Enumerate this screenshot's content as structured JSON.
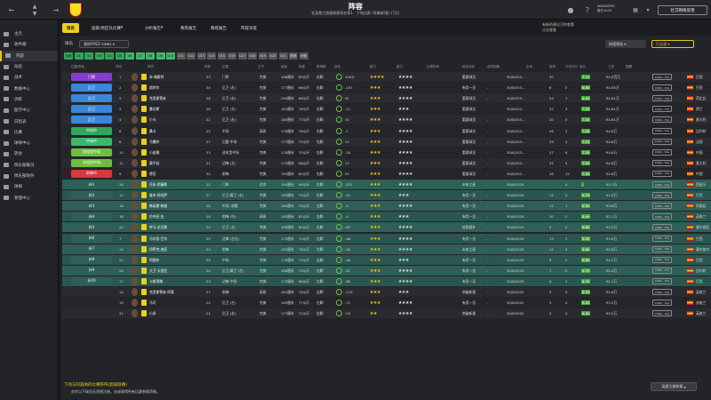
{
  "topbar": {
    "title": "阵容",
    "subtitle": "在英格兰超级联赛排名第1 - 下场比赛: 阿森纳(客) (7天)",
    "club_button": "社交网络反馈",
    "manager_line1": "WAKSATRO",
    "manager_line2": "周日 8:00"
  },
  "sidebar": {
    "items": [
      {
        "label": "主页",
        "active": false
      },
      {
        "label": "收件箱",
        "active": false
      },
      {
        "label": "阵容",
        "active": true
      },
      {
        "label": "动态",
        "active": false
      },
      {
        "label": "战术",
        "active": false
      },
      {
        "label": "数据中心",
        "active": false
      },
      {
        "label": "训练",
        "active": false
      },
      {
        "label": "医疗中心",
        "active": false
      },
      {
        "label": "日程表",
        "active": false
      },
      {
        "label": "比赛",
        "active": false
      },
      {
        "label": "球探中心",
        "active": false
      },
      {
        "label": "转会",
        "active": false
      },
      {
        "label": "俱乐部概况",
        "active": false
      },
      {
        "label": "俱乐部财务",
        "active": false
      },
      {
        "label": "球探",
        "active": false
      },
      {
        "label": "管理中心",
        "active": false
      }
    ]
  },
  "tabs": [
    {
      "label": "球员",
      "active": true
    },
    {
      "label": "国家/地区队比赛",
      "active": false
    },
    {
      "label": "分析报告",
      "active": false
    },
    {
      "label": "教练报告",
      "active": false
    },
    {
      "label": "教练报告",
      "active": false
    },
    {
      "label": "阵容深度",
      "active": false
    }
  ],
  "notice": {
    "line1": "有新的建议可供查看",
    "line2": "点击查看"
  },
  "filters": {
    "label": "球员",
    "view_select": "我的FM22 views",
    "quick_select": "快速筛选",
    "used_select": "已过滤"
  },
  "chips": [
    "全部",
    "U1",
    "U2",
    "U3",
    "U4",
    "U5",
    "U6",
    "U7",
    "U8",
    "U9",
    "U10",
    "U11",
    "U12",
    "U13",
    "U14",
    "U15",
    "U16",
    "U17",
    "U18",
    "U19",
    "U20",
    "U21",
    "联赛",
    "杯赛"
  ],
  "columns": [
    "位置/角色",
    "号码",
    "球员",
    "年龄",
    "位置",
    "主气",
    "身高",
    "体重",
    "惯用脚",
    "状态",
    "能力",
    "潜力",
    "比赛时间",
    "转会状态",
    "合同到期",
    "出场",
    "进球",
    "平均评分",
    "身价",
    "工资",
    "国籍"
  ],
  "colors": {
    "accent": "#f2cf1d",
    "gk": "#8a3bd4",
    "def": "#3a86d8",
    "dm": "#2fa85a",
    "mid": "#3cb86a",
    "wing": "#6fbf3f",
    "att": "#d63a3a",
    "sub": "#2f5f57"
  },
  "rows": [
    {
      "role": "门将",
      "pos_color": "#8a3bd4",
      "num": "1",
      "name": "本·福斯特",
      "age": "33",
      "pos": "门将",
      "pers": "完美",
      "height": "188厘米",
      "weight": "85公斤",
      "foot": "右脚",
      "status": "",
      "fitness": "100%",
      "ability": "★★★★",
      "potential": "★★★★",
      "time": "重要球员",
      "transfer": "-",
      "contract": "30/6/203...",
      "apps": "30",
      "goals": "-",
      "rating": "7.10",
      "value": "€4.8百万",
      "wage": "CS6K - CSL",
      "nat": "巴西"
    },
    {
      "role": "后卫",
      "pos_color": "#3a86d8",
      "num": "2",
      "name": "凯特尔",
      "age": "24",
      "pos": "后卫 (右)",
      "pers": "完美",
      "height": "177厘米",
      "weight": "66公斤",
      "foot": "右脚",
      "status": "",
      "fitness": "-157",
      "ability": "★★★",
      "potential": "★★★★",
      "time": "有用一员",
      "transfer": "-",
      "contract": "30/6/203...",
      "apps": "6",
      "goals": "0",
      "rating": "6.80",
      "value": "€4.85万",
      "wage": "CS6K - CSL",
      "nat": "巴西"
    },
    {
      "role": "后卫",
      "pos_color": "#3a86d8",
      "num": "5",
      "name": "克里斯蒂安",
      "age": "26",
      "pos": "后卫 (右)",
      "pers": "完美",
      "height": "194厘米",
      "weight": "86公斤",
      "foot": "右脚",
      "status": "",
      "fitness": "91",
      "ability": "★★★",
      "potential": "★★★★",
      "time": "重要球员",
      "transfer": "-",
      "contract": "30/6/203...",
      "apps": "24",
      "goals": "1",
      "rating": "6.90",
      "value": "€4.81万",
      "wage": "CS6K - CSL",
      "nat": "荷比比"
    },
    {
      "role": "后卫",
      "pos_color": "#3a86d8",
      "num": "3",
      "name": "桑切斯",
      "age": "28",
      "pos": "后卫 (左)",
      "pers": "完美",
      "height": "181厘米",
      "weight": "78公斤",
      "foot": "左脚",
      "status": "",
      "fitness": "-11",
      "ability": "★★★",
      "potential": "★★★",
      "time": "重要球员",
      "transfer": "-",
      "contract": "30/6/203...",
      "apps": "22",
      "goals": "3",
      "rating": "7.00",
      "value": "€4.81万",
      "wage": "CS6K - CSL",
      "nat": "荷兰"
    },
    {
      "role": "后卫",
      "pos_color": "#3a86d8",
      "num": "4",
      "name": "小卡",
      "age": "22",
      "pos": "后卫 (右)",
      "pers": "完美",
      "height": "180厘米",
      "weight": "77公斤",
      "foot": "右脚",
      "status": "",
      "fitness": "10",
      "ability": "★★★",
      "potential": "★★★★",
      "time": "重要球员",
      "transfer": "-",
      "contract": "30/6/203...",
      "apps": "20",
      "goals": "0",
      "rating": "7.10",
      "value": "€4.81万",
      "wage": "CS6K - CSL",
      "nat": "意大利"
    },
    {
      "role": "中场中",
      "pos_color": "#2fa85a",
      "num": "6",
      "name": "桑卡",
      "age": "25",
      "pos": "中场",
      "pers": "高昂",
      "height": "178厘米",
      "weight": "76公斤",
      "foot": "右脚",
      "status": "",
      "fitness": "-1",
      "ability": "★★★",
      "potential": "★★★★",
      "time": "重要球员",
      "transfer": "-",
      "contract": "30/6/203...",
      "apps": "26",
      "goals": "2",
      "rating": "7.00",
      "value": "€4.8万",
      "wage": "CS6K - CSL",
      "nat": "比利时"
    },
    {
      "role": "中场中",
      "pos_color": "#3cb86a",
      "num": "8",
      "name": "马撒朴",
      "age": "27",
      "pos": "后腰 中场",
      "pers": "完美",
      "height": "177厘米",
      "weight": "72公斤",
      "foot": "右脚",
      "status": "",
      "fitness": "13",
      "ability": "★★★",
      "potential": "★★★★",
      "time": "重要球员",
      "transfer": "-",
      "contract": "30/6/203...",
      "apps": "29",
      "goals": "4",
      "rating": "7.10",
      "value": "€4.8万",
      "wage": "CS6K - CSL",
      "nat": "法国"
    },
    {
      "role": "进攻型中场",
      "pos_color": "#6fbf3f",
      "num": "10",
      "name": "小皮雅",
      "age": "23",
      "pos": "进攻型中场",
      "pers": "完美",
      "height": "176厘米",
      "weight": "70公斤",
      "foot": "右脚",
      "status": "",
      "fitness": "-18",
      "ability": "★★★",
      "potential": "★★★★",
      "time": "重要球员",
      "transfer": "-",
      "contract": "30/6/203...",
      "apps": "27",
      "goals": "6",
      "rating": "7.20",
      "value": "€4.8万",
      "wage": "CS6K - CSL",
      "nat": "中国"
    },
    {
      "role": "进攻型中场",
      "pos_color": "#6fbf3f",
      "num": "11",
      "name": "赛不丝",
      "age": "21",
      "pos": "边锋 (左)",
      "pers": "完美",
      "height": "172厘米",
      "weight": "68公斤",
      "foot": "左脚",
      "status": "",
      "fitness": "13",
      "ability": "★★★",
      "potential": "★★★★",
      "time": "重要球员",
      "transfer": "-",
      "contract": "30/6/203...",
      "apps": "25",
      "goals": "5",
      "rating": "7.00",
      "value": "€4.8万",
      "wage": "CS6K - CSL",
      "nat": "意大利"
    },
    {
      "role": "前锋中",
      "pos_color": "#d63a3a",
      "num": "9",
      "name": "德尼",
      "age": "30",
      "pos": "前锋",
      "pers": "完美",
      "height": "183厘米",
      "weight": "80公斤",
      "foot": "右脚",
      "status": "",
      "fitness": "30",
      "ability": "★★★",
      "potential": "★★★★",
      "time": "重要球员",
      "transfer": "-",
      "contract": "30/6/203...",
      "apps": "28",
      "goals": "12",
      "rating": "7.30",
      "value": "€4.8万",
      "wage": "CS6K - CSL",
      "nat": "中国"
    },
    {
      "role": "补1",
      "pos_color": "#2f5f57",
      "num": "26",
      "name": "丹米·伊藤斯",
      "age": "22",
      "pos": "门将",
      "pers": "优秀",
      "height": "194厘米",
      "weight": "90公斤",
      "foot": "右脚",
      "status": "",
      "fitness": "-221",
      "ability": "★★★",
      "potential": "★★★★",
      "time": "未来之星",
      "transfer": "-",
      "contract": "30/6/2029",
      "apps": "-",
      "goals": "0",
      "rating": "-",
      "value": "€3.7万",
      "wage": "CS6K - CSL",
      "nat": "西班牙"
    },
    {
      "role": "补2",
      "pos_color": "#2f5f57",
      "num": "12",
      "name": "鲁本·阿拉萨",
      "age": "27",
      "pos": "后卫/翼卫 (右)",
      "pers": "完美",
      "height": "180厘米",
      "weight": "75公斤",
      "foot": "右脚",
      "status": "",
      "fitness": "-91",
      "ability": "★★★",
      "potential": "★★★",
      "time": "有用一员",
      "transfer": "-",
      "contract": "30/6/2029",
      "apps": "14",
      "goals": "0",
      "rating": "6.70",
      "value": "€1.8万",
      "wage": "CS6K - CSL",
      "nat": "巴西"
    },
    {
      "role": "补3",
      "pos_color": "#2f5f57",
      "num": "16",
      "name": "韩诺斯·勒波",
      "age": "26",
      "pos": "中场, 前腰",
      "pers": "完美",
      "height": "180厘米",
      "weight": "74公斤",
      "foot": "右脚",
      "status": "",
      "fitness": "-9",
      "ability": "★★★",
      "potential": "★★★★",
      "time": "有用一员",
      "transfer": "-",
      "contract": "30/6/2029",
      "apps": "11",
      "goals": "1",
      "rating": "6.80",
      "value": "€3.8万",
      "wage": "CS6K - CSL",
      "nat": "阿根廷"
    },
    {
      "role": "补4",
      "pos_color": "#2f5f57",
      "num": "18",
      "name": "约书亚·金",
      "age": "29",
      "pos": "前锋 (中)",
      "pers": "高昂",
      "height": "185厘米",
      "weight": "81公斤",
      "foot": "右脚",
      "status": "",
      "fitness": "-4",
      "ability": "★★★",
      "potential": "★★★",
      "time": "有用一员",
      "transfer": "-",
      "contract": "30/6/2029",
      "apps": "10",
      "goals": "2",
      "rating": "6.90",
      "value": "€2.1万",
      "wage": "CS6K - CSL",
      "nat": "英格兰"
    },
    {
      "role": "补5",
      "pos_color": "#2f5f57",
      "num": "20",
      "name": "库马·达尼斯",
      "age": "24",
      "pos": "后卫 (左)",
      "pers": "完美",
      "height": "186厘米",
      "weight": "80公斤",
      "foot": "左脚",
      "status": "",
      "fitness": "-87",
      "ability": "★★★",
      "potential": "★★★★",
      "time": "轮换替补",
      "transfer": "-",
      "contract": "30/6/2029",
      "apps": "9",
      "goals": "0",
      "rating": "6.60",
      "value": "€3.3万",
      "wage": "CS6K - CSL",
      "nat": "塞尔维亚"
    },
    {
      "role": "补6",
      "pos_color": "#2f5f57",
      "num": "7",
      "name": "马尔彭·巴尔",
      "age": "25",
      "pos": "边锋 (左右)",
      "pers": "完美",
      "height": "175厘米",
      "weight": "70公斤",
      "foot": "右脚",
      "status": "",
      "fitness": "-48",
      "ability": "★★★",
      "potential": "★★★★",
      "time": "有用一员",
      "transfer": "-",
      "contract": "30/6/2029",
      "apps": "13",
      "goals": "2",
      "rating": "6.90",
      "value": "€3.6万",
      "wage": "CS6K - CSL",
      "nat": "巴西"
    },
    {
      "role": "补7",
      "pos_color": "#2f5f57",
      "num": "19",
      "name": "伊萨克·迪亚",
      "age": "23",
      "pos": "前锋",
      "pers": "完美",
      "height": "182厘米",
      "weight": "78公斤",
      "foot": "右脚",
      "status": "",
      "fitness": "-45",
      "ability": "★★★",
      "potential": "★★★★",
      "time": "未来之星",
      "transfer": "-",
      "contract": "30/6/2029",
      "apps": "12",
      "goals": "3",
      "rating": "6.80",
      "value": "€2.6万",
      "wage": "CS6K - CSL",
      "nat": "塞内加尔"
    },
    {
      "role": "补8",
      "pos_color": "#2f5f57",
      "num": "22",
      "name": "阿图尔",
      "age": "28",
      "pos": "中场",
      "pers": "完美",
      "height": "179厘米",
      "weight": "73公斤",
      "foot": "右脚",
      "status": "",
      "fitness": "-46",
      "ability": "★★★",
      "potential": "★★★",
      "time": "有用一员",
      "transfer": "-",
      "contract": "30/6/2029",
      "apps": "8",
      "goals": "0",
      "rating": "6.80",
      "value": "€2.2万",
      "wage": "CS6K - CSL",
      "nat": "巴西"
    },
    {
      "role": "补9",
      "pos_color": "#2f5f57",
      "num": "24",
      "name": "大卫·卡里亚",
      "age": "24",
      "pos": "后卫/翼卫 (右)",
      "pers": "完美",
      "height": "186厘米",
      "weight": "79公斤",
      "foot": "右脚",
      "status": "",
      "fitness": "-61",
      "ability": "★★★",
      "potential": "★★★★",
      "time": "有用一员",
      "transfer": "-",
      "contract": "30/6/2029",
      "apps": "7",
      "goals": "0",
      "rating": "6.70",
      "value": "€2.4万",
      "wage": "CS6K - CSL",
      "nat": "比利时"
    },
    {
      "role": "补10",
      "pos_color": "#2f5f57",
      "num": "17",
      "name": "卡斯蒂略",
      "age": "23",
      "pos": "边锋 中场",
      "pers": "完美",
      "height": "173厘米",
      "weight": "68公斤",
      "foot": "左脚",
      "status": "",
      "fitness": "-88",
      "ability": "★★★",
      "potential": "★★★★",
      "time": "有用一员",
      "transfer": "-",
      "contract": "30/6/2029",
      "apps": "6",
      "goals": "1",
      "rating": "6.70",
      "value": "€2.1万",
      "wage": "CS6K - CSL",
      "nat": "巴西"
    },
    {
      "role": "",
      "pos_color": "",
      "num": "14",
      "name": "克里斯蒂安·阿莫",
      "age": "27",
      "pos": "前锋",
      "pers": "高昂",
      "height": "181厘米",
      "weight": "76公斤",
      "foot": "右脚",
      "status": "",
      "fitness": "-176",
      "ability": "★★★",
      "potential": "★★★",
      "time": "突破新援",
      "transfer": "-",
      "contract": "30/6/2025",
      "apps": "5",
      "goals": "0",
      "rating": "6.50",
      "value": "€4.6万",
      "wage": "CS6K - CSL",
      "nat": "英格兰"
    },
    {
      "role": "",
      "pos_color": "",
      "num": "15",
      "name": "马可",
      "age": "22",
      "pos": "后卫 (左)",
      "pers": "完美",
      "height": "183厘米",
      "weight": "77公斤",
      "foot": "左脚",
      "status": "",
      "fitness": "-72",
      "ability": "★★★",
      "potential": "★★★★",
      "time": "有用一员",
      "transfer": "-",
      "contract": "30/6/2025",
      "apps": "3",
      "goals": "0",
      "rating": "6.40",
      "value": "€3.3万",
      "wage": "CS6K - CSL",
      "nat": "苏格兰"
    },
    {
      "role": "",
      "pos_color": "",
      "num": "21",
      "name": "小多",
      "age": "21",
      "pos": "后卫 (右)",
      "pers": "完美",
      "height": "177厘米",
      "weight": "72公斤",
      "foot": "右脚",
      "status": "",
      "fitness": "-53",
      "ability": "★★",
      "potential": "★★★★",
      "time": "突破新援",
      "transfer": "-",
      "contract": "30/6/2025",
      "apps": "2",
      "goals": "0",
      "rating": "6.30",
      "value": "€3.0万",
      "wage": "CS6K - CSL",
      "nat": "英格兰"
    }
  ],
  "footer": {
    "line1": "下场与阿森纳的比赛阵阵(超级联赛)",
    "line2": "亦步以下球员无资格注册，击成获得所有比赛参赛资格。",
    "button": "英超注册联赛"
  }
}
